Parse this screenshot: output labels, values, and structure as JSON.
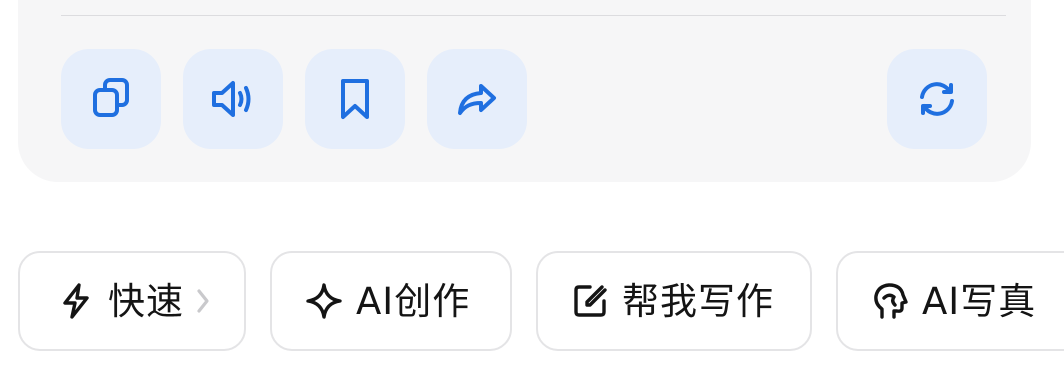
{
  "actions": {
    "copy": {
      "icon": "copy-icon"
    },
    "speak": {
      "icon": "speaker-icon"
    },
    "bookmark": {
      "icon": "bookmark-icon"
    },
    "share": {
      "icon": "share-icon"
    },
    "regenerate": {
      "icon": "refresh-icon"
    }
  },
  "chips": [
    {
      "label": "快速",
      "icon": "lightning-icon",
      "has_chevron": true
    },
    {
      "label": "AI创作",
      "icon": "sparkle-icon"
    },
    {
      "label": "帮我写作",
      "icon": "edit-icon"
    },
    {
      "label": "AI写真",
      "icon": "portrait-icon"
    }
  ],
  "colors": {
    "accent": "#1f6fe0",
    "action_bg": "#e6eefb",
    "card_bg": "#f6f6f7",
    "chip_border": "#e4e4e6"
  }
}
